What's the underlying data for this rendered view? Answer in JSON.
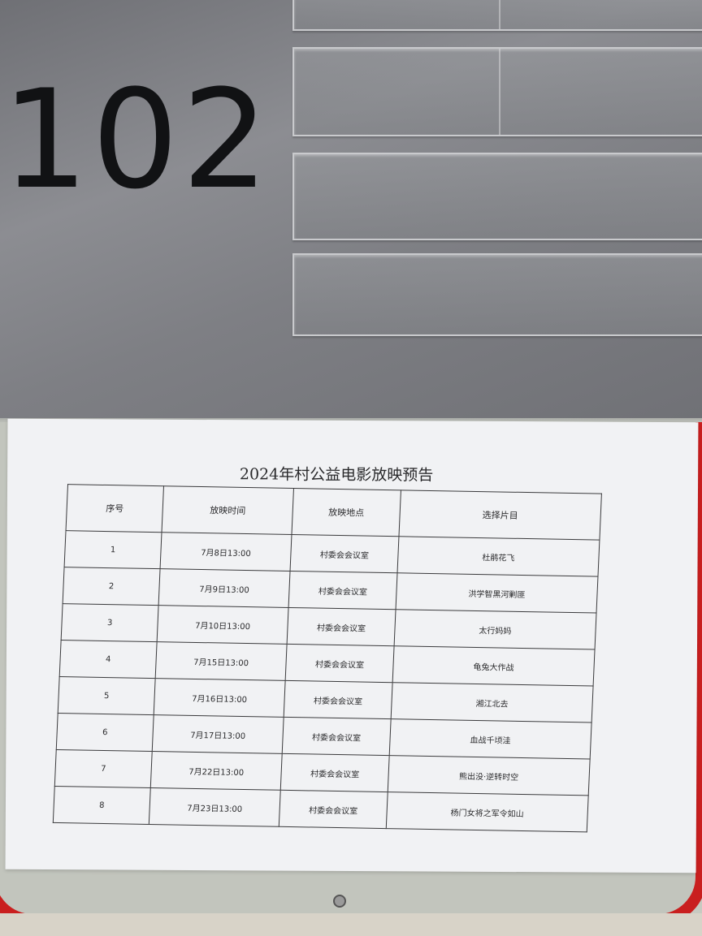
{
  "door_plate": {
    "room_number": "102"
  },
  "notice": {
    "title": "2024年村公益电影放映预告",
    "columns": [
      "序号",
      "放映时间",
      "放映地点",
      "选择片目"
    ],
    "rows": [
      {
        "no": "1",
        "time": "7月8日13:00",
        "place": "村委会会议室",
        "film": "杜鹃花飞"
      },
      {
        "no": "2",
        "time": "7月9日13:00",
        "place": "村委会会议室",
        "film": "洪学智黑河剿匪"
      },
      {
        "no": "3",
        "time": "7月10日13:00",
        "place": "村委会会议室",
        "film": "太行妈妈"
      },
      {
        "no": "4",
        "time": "7月15日13:00",
        "place": "村委会会议室",
        "film": "龟兔大作战"
      },
      {
        "no": "5",
        "time": "7月16日13:00",
        "place": "村委会会议室",
        "film": "湘江北去"
      },
      {
        "no": "6",
        "time": "7月17日13:00",
        "place": "村委会会议室",
        "film": "血战千顷洼"
      },
      {
        "no": "7",
        "time": "7月22日13:00",
        "place": "村委会会议室",
        "film": "熊出没·逆转时空"
      },
      {
        "no": "8",
        "time": "7月23日13:00",
        "place": "村委会会议室",
        "film": "杨门女将之军令如山"
      }
    ]
  },
  "colors": {
    "board_frame": "#c91f1f",
    "paper": "#f1f2f4",
    "wall": "#8c8d92"
  }
}
